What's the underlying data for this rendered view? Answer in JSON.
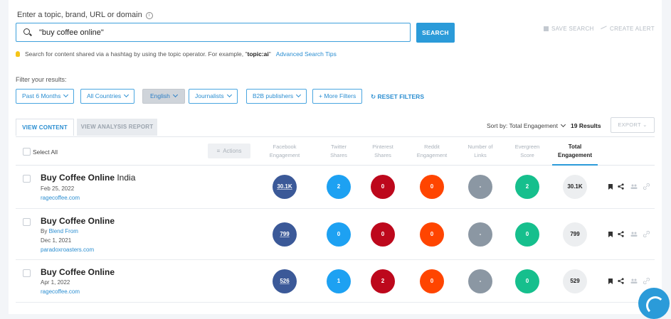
{
  "search": {
    "label": "Enter a topic, brand, URL or domain",
    "info_icon": "info-icon",
    "query": "\"buy coffee online\"",
    "button_label": "SEARCH",
    "save_search": "SAVE SEARCH",
    "create_alert": "CREATE ALERT"
  },
  "tip": {
    "text_before": "Search for content shared via a hashtag by using the topic operator. For example, \"",
    "example": "topic:ai",
    "text_after": "\"",
    "link": "Advanced Search Tips"
  },
  "filters": {
    "label": "Filter your results:",
    "chips": [
      "Past 6 Months",
      "All Countries",
      "English",
      "Journalists",
      "B2B publishers"
    ],
    "more": "+ More Filters",
    "reset": "RESET FILTERS"
  },
  "tabs": {
    "view_content": "VIEW CONTENT",
    "view_analysis": "VIEW ANALYSIS REPORT"
  },
  "sort": {
    "label": "Sort by: Total Engagement",
    "results": "19 Results",
    "export": "EXPORT"
  },
  "table": {
    "select_all": "Select All",
    "actions": "Actions",
    "columns": [
      [
        "Facebook",
        "Engagement"
      ],
      [
        "Twitter",
        "Shares"
      ],
      [
        "Pinterest",
        "Shares"
      ],
      [
        "Reddit",
        "Engagement"
      ],
      [
        "Number of",
        "Links"
      ],
      [
        "Evergreen",
        "Score"
      ],
      [
        "Total",
        "Engagement"
      ]
    ],
    "rows": [
      {
        "title_bold": "Buy Coffee Online",
        "title_rest": " India",
        "date": "Feb 25, 2022",
        "domain": "ragecoffee.com",
        "facebook": "30.1K",
        "twitter": "2",
        "pinterest": "0",
        "reddit": "0",
        "links": "-",
        "evergreen": "2",
        "total": "30.1K"
      },
      {
        "title_bold": "Buy Coffee Online",
        "title_rest": "",
        "by_prefix": "By",
        "author": "Blend From",
        "date": "Dec 1, 2021",
        "domain": "paradoxroasters.com",
        "facebook": "799",
        "twitter": "0",
        "pinterest": "0",
        "reddit": "0",
        "links": "-",
        "evergreen": "0",
        "total": "799"
      },
      {
        "title_bold": "Buy Coffee Online",
        "title_rest": "",
        "date": "Apr 1, 2022",
        "domain": "ragecoffee.com",
        "facebook": "526",
        "twitter": "1",
        "pinterest": "2",
        "reddit": "0",
        "links": "-",
        "evergreen": "0",
        "total": "529"
      }
    ]
  },
  "colors": {
    "accent": "#2b9bd9",
    "facebook": "#3b5998",
    "twitter": "#1da1f2",
    "pinterest": "#bd081c",
    "reddit": "#ff4500",
    "links": "#8b97a3",
    "evergreen": "#16bf8d"
  }
}
